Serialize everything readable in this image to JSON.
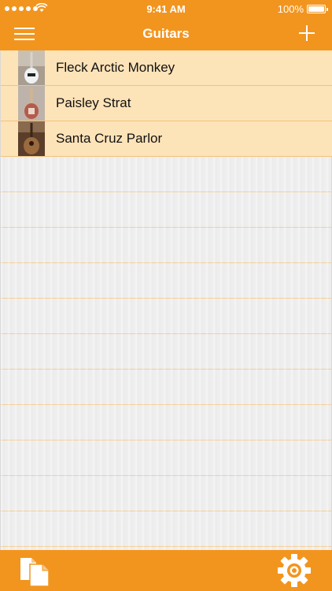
{
  "status_bar": {
    "time": "9:41 AM",
    "battery_percent": "100%",
    "signal_icon": "signal-dots-icon",
    "wifi_icon": "wifi-icon",
    "battery_icon": "battery-icon"
  },
  "nav": {
    "title": "Guitars",
    "left_icon": "hamburger-menu-icon",
    "right_icon": "plus-icon"
  },
  "guitars": [
    {
      "name": "Fleck Arctic Monkey",
      "thumb_color": "#cfd3d6"
    },
    {
      "name": "Paisley Strat",
      "thumb_color": "#b65a4c"
    },
    {
      "name": "Santa Cruz Parlor",
      "thumb_color": "#7a4c2b"
    }
  ],
  "toolbar": {
    "left_icon": "documents-icon",
    "right_icon": "gear-icon"
  },
  "colors": {
    "accent": "#f2951f",
    "row_fill": "#fde3b8",
    "rule_line": "#f6cf97"
  }
}
